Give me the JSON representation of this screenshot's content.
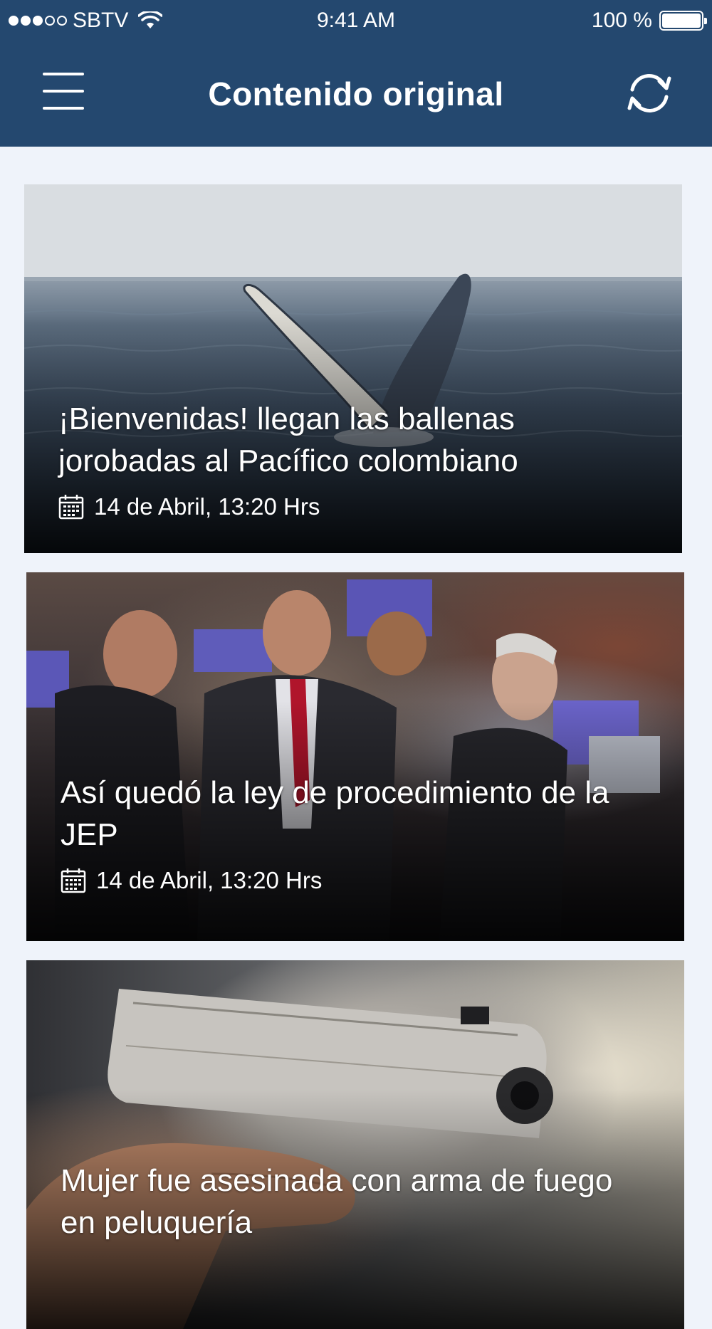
{
  "status_bar": {
    "carrier": "SBTV",
    "time": "9:41 AM",
    "battery": "100 %"
  },
  "nav": {
    "title": "Contenido original",
    "left_icon": "menu-icon",
    "right_icon": "refresh-icon"
  },
  "articles": [
    {
      "title": "¡Bienvenidas! llegan las ballenas jorobadas al Pacífico colombiano",
      "date": "14 de Abril, 13:20 Hrs",
      "image": "humpback whale breaching ocean"
    },
    {
      "title": "Así quedó la ley de procedimiento de la JEP",
      "date": "14 de Abril, 13:20 Hrs",
      "image": "congress members talking"
    },
    {
      "title": "Mujer fue asesinada con arma de fuego en peluquería",
      "image": "hand holding pistol"
    }
  ],
  "colors": {
    "header": "#24486f",
    "background": "#eff3fa",
    "text_on_image": "#ffffff"
  }
}
